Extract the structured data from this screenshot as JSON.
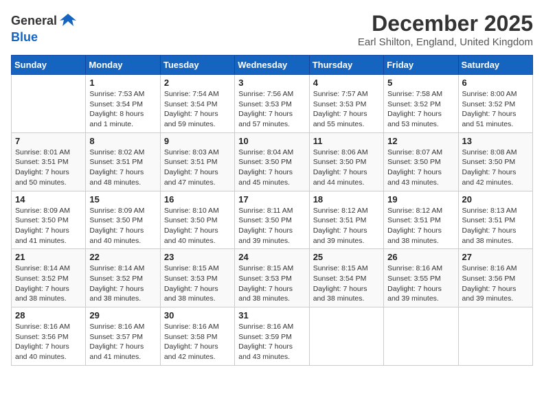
{
  "header": {
    "logo_general": "General",
    "logo_blue": "Blue",
    "month_title": "December 2025",
    "location": "Earl Shilton, England, United Kingdom"
  },
  "days_of_week": [
    "Sunday",
    "Monday",
    "Tuesday",
    "Wednesday",
    "Thursday",
    "Friday",
    "Saturday"
  ],
  "weeks": [
    [
      {
        "day": "",
        "info": ""
      },
      {
        "day": "1",
        "info": "Sunrise: 7:53 AM\nSunset: 3:54 PM\nDaylight: 8 hours\nand 1 minute."
      },
      {
        "day": "2",
        "info": "Sunrise: 7:54 AM\nSunset: 3:54 PM\nDaylight: 7 hours\nand 59 minutes."
      },
      {
        "day": "3",
        "info": "Sunrise: 7:56 AM\nSunset: 3:53 PM\nDaylight: 7 hours\nand 57 minutes."
      },
      {
        "day": "4",
        "info": "Sunrise: 7:57 AM\nSunset: 3:53 PM\nDaylight: 7 hours\nand 55 minutes."
      },
      {
        "day": "5",
        "info": "Sunrise: 7:58 AM\nSunset: 3:52 PM\nDaylight: 7 hours\nand 53 minutes."
      },
      {
        "day": "6",
        "info": "Sunrise: 8:00 AM\nSunset: 3:52 PM\nDaylight: 7 hours\nand 51 minutes."
      }
    ],
    [
      {
        "day": "7",
        "info": "Sunrise: 8:01 AM\nSunset: 3:51 PM\nDaylight: 7 hours\nand 50 minutes."
      },
      {
        "day": "8",
        "info": "Sunrise: 8:02 AM\nSunset: 3:51 PM\nDaylight: 7 hours\nand 48 minutes."
      },
      {
        "day": "9",
        "info": "Sunrise: 8:03 AM\nSunset: 3:51 PM\nDaylight: 7 hours\nand 47 minutes."
      },
      {
        "day": "10",
        "info": "Sunrise: 8:04 AM\nSunset: 3:50 PM\nDaylight: 7 hours\nand 45 minutes."
      },
      {
        "day": "11",
        "info": "Sunrise: 8:06 AM\nSunset: 3:50 PM\nDaylight: 7 hours\nand 44 minutes."
      },
      {
        "day": "12",
        "info": "Sunrise: 8:07 AM\nSunset: 3:50 PM\nDaylight: 7 hours\nand 43 minutes."
      },
      {
        "day": "13",
        "info": "Sunrise: 8:08 AM\nSunset: 3:50 PM\nDaylight: 7 hours\nand 42 minutes."
      }
    ],
    [
      {
        "day": "14",
        "info": "Sunrise: 8:09 AM\nSunset: 3:50 PM\nDaylight: 7 hours\nand 41 minutes."
      },
      {
        "day": "15",
        "info": "Sunrise: 8:09 AM\nSunset: 3:50 PM\nDaylight: 7 hours\nand 40 minutes."
      },
      {
        "day": "16",
        "info": "Sunrise: 8:10 AM\nSunset: 3:50 PM\nDaylight: 7 hours\nand 40 minutes."
      },
      {
        "day": "17",
        "info": "Sunrise: 8:11 AM\nSunset: 3:50 PM\nDaylight: 7 hours\nand 39 minutes."
      },
      {
        "day": "18",
        "info": "Sunrise: 8:12 AM\nSunset: 3:51 PM\nDaylight: 7 hours\nand 39 minutes."
      },
      {
        "day": "19",
        "info": "Sunrise: 8:12 AM\nSunset: 3:51 PM\nDaylight: 7 hours\nand 38 minutes."
      },
      {
        "day": "20",
        "info": "Sunrise: 8:13 AM\nSunset: 3:51 PM\nDaylight: 7 hours\nand 38 minutes."
      }
    ],
    [
      {
        "day": "21",
        "info": "Sunrise: 8:14 AM\nSunset: 3:52 PM\nDaylight: 7 hours\nand 38 minutes."
      },
      {
        "day": "22",
        "info": "Sunrise: 8:14 AM\nSunset: 3:52 PM\nDaylight: 7 hours\nand 38 minutes."
      },
      {
        "day": "23",
        "info": "Sunrise: 8:15 AM\nSunset: 3:53 PM\nDaylight: 7 hours\nand 38 minutes."
      },
      {
        "day": "24",
        "info": "Sunrise: 8:15 AM\nSunset: 3:53 PM\nDaylight: 7 hours\nand 38 minutes."
      },
      {
        "day": "25",
        "info": "Sunrise: 8:15 AM\nSunset: 3:54 PM\nDaylight: 7 hours\nand 38 minutes."
      },
      {
        "day": "26",
        "info": "Sunrise: 8:16 AM\nSunset: 3:55 PM\nDaylight: 7 hours\nand 39 minutes."
      },
      {
        "day": "27",
        "info": "Sunrise: 8:16 AM\nSunset: 3:56 PM\nDaylight: 7 hours\nand 39 minutes."
      }
    ],
    [
      {
        "day": "28",
        "info": "Sunrise: 8:16 AM\nSunset: 3:56 PM\nDaylight: 7 hours\nand 40 minutes."
      },
      {
        "day": "29",
        "info": "Sunrise: 8:16 AM\nSunset: 3:57 PM\nDaylight: 7 hours\nand 41 minutes."
      },
      {
        "day": "30",
        "info": "Sunrise: 8:16 AM\nSunset: 3:58 PM\nDaylight: 7 hours\nand 42 minutes."
      },
      {
        "day": "31",
        "info": "Sunrise: 8:16 AM\nSunset: 3:59 PM\nDaylight: 7 hours\nand 43 minutes."
      },
      {
        "day": "",
        "info": ""
      },
      {
        "day": "",
        "info": ""
      },
      {
        "day": "",
        "info": ""
      }
    ]
  ]
}
